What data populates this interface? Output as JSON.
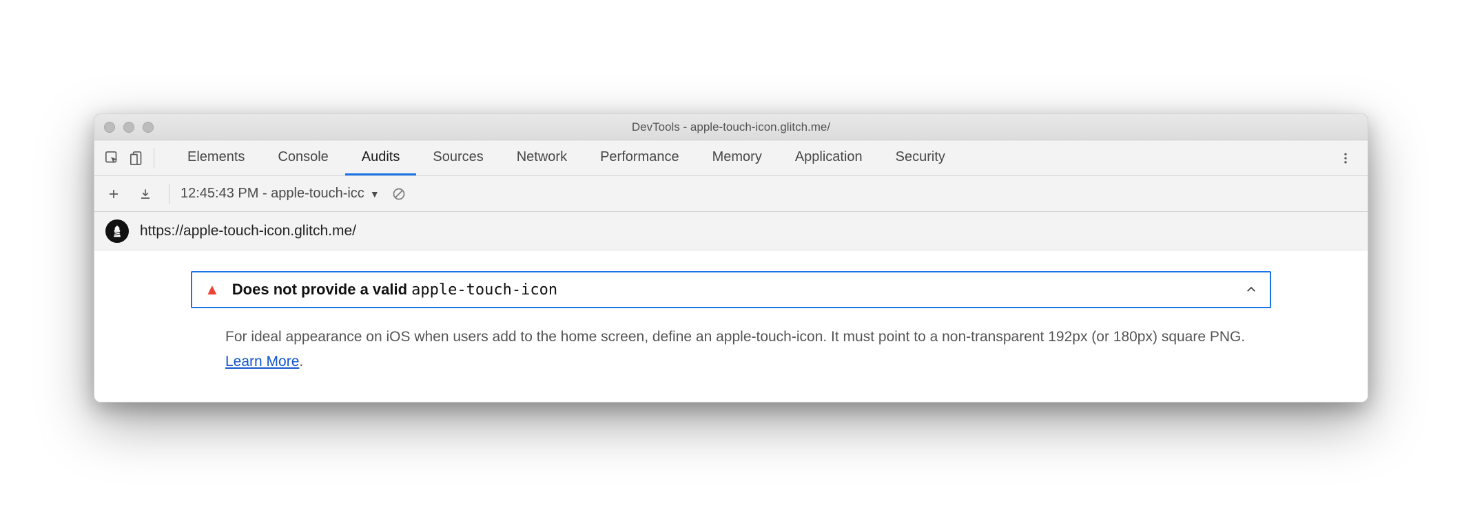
{
  "window": {
    "title": "DevTools - apple-touch-icon.glitch.me/"
  },
  "tabs": {
    "items": [
      {
        "label": "Elements"
      },
      {
        "label": "Console"
      },
      {
        "label": "Audits"
      },
      {
        "label": "Sources"
      },
      {
        "label": "Network"
      },
      {
        "label": "Performance"
      },
      {
        "label": "Memory"
      },
      {
        "label": "Application"
      },
      {
        "label": "Security"
      }
    ],
    "active_index": 2
  },
  "toolbar": {
    "run_select": "12:45:43 PM - apple-touch-icc"
  },
  "urlbar": {
    "url": "https://apple-touch-icon.glitch.me/"
  },
  "audit": {
    "title_prefix": "Does not provide a valid ",
    "title_code": "apple-touch-icon",
    "description": "For ideal appearance on iOS when users add to the home screen, define an apple-touch-icon. It must point to a non-transparent 192px (or 180px) square PNG. ",
    "learn_more": "Learn More",
    "period": "."
  }
}
